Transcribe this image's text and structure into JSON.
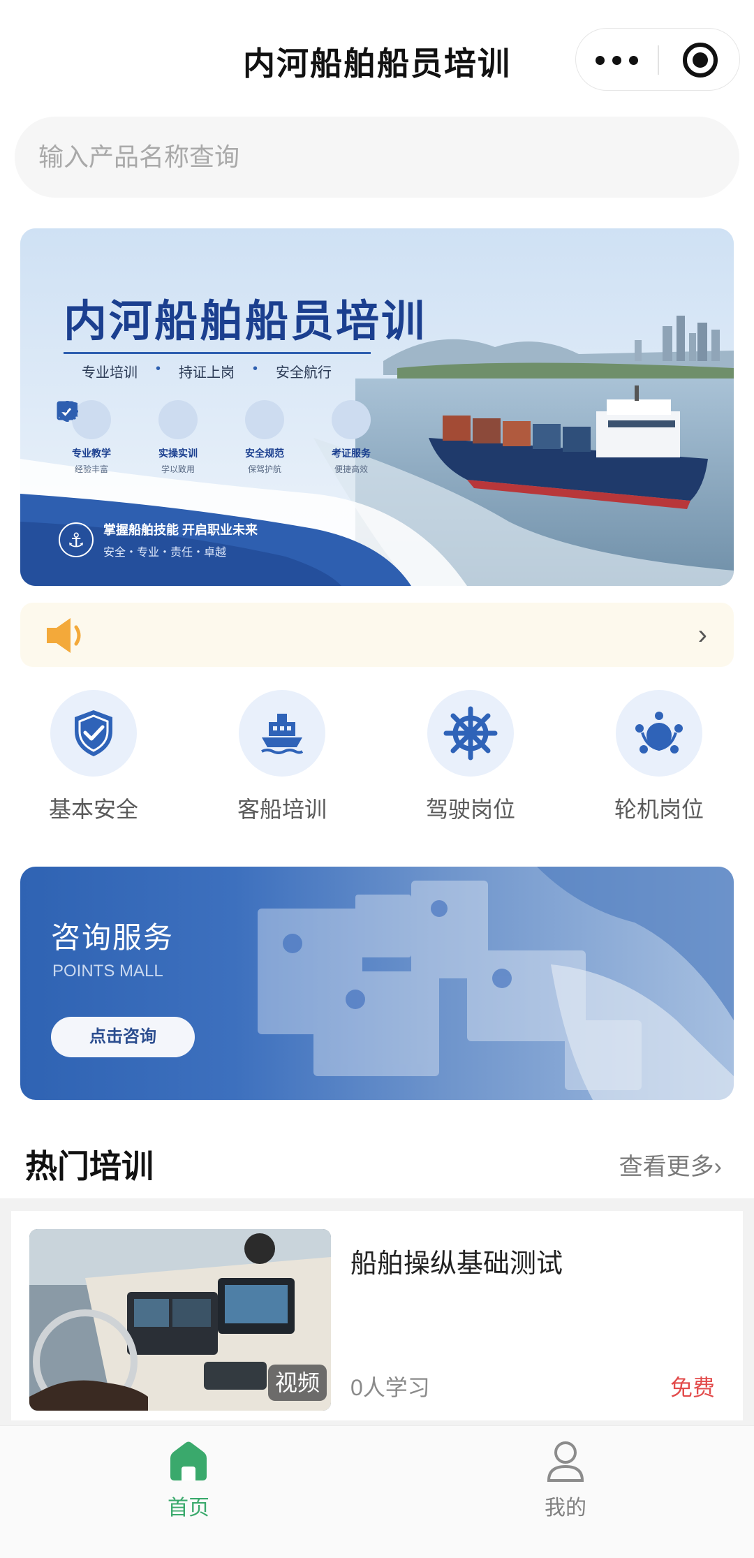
{
  "navbar": {
    "title": "内河船舶船员培训"
  },
  "search": {
    "placeholder": "输入产品名称查询"
  },
  "hero": {
    "title": "内河船舶船员培训",
    "tags": [
      "专业培训",
      "持证上岗",
      "安全航行"
    ],
    "features": [
      {
        "name": "专业教学",
        "sub": "经验丰富",
        "icon": "book-icon"
      },
      {
        "name": "实操实训",
        "sub": "学以致用",
        "icon": "ship-wheel-icon"
      },
      {
        "name": "安全规范",
        "sub": "保驾护航",
        "icon": "shield-check-icon"
      },
      {
        "name": "考证服务",
        "sub": "便捷高效",
        "icon": "certificate-icon"
      }
    ],
    "slogan_main": "掌握船舶技能  开启职业未来",
    "slogan_sub": "安全・专业・责任・卓越"
  },
  "notice": {
    "icon": "speaker-icon"
  },
  "categories": [
    {
      "label": "基本安全",
      "icon": "shield-check-icon"
    },
    {
      "label": "客船培训",
      "icon": "ship-icon"
    },
    {
      "label": "驾驶岗位",
      "icon": "ship-wheel-icon"
    },
    {
      "label": "轮机岗位",
      "icon": "engine-crew-icon"
    }
  ],
  "consult": {
    "title": "咨询服务",
    "subtitle": "POINTS MALL",
    "button": "点击咨询"
  },
  "section": {
    "title": "热门培训",
    "more": "查看更多"
  },
  "courses": [
    {
      "title": "船舶操纵基础测试",
      "badge": "视频",
      "learners": "0人学习",
      "price": "免费"
    }
  ],
  "tabbar": {
    "items": [
      {
        "label": "首页",
        "icon": "home-icon",
        "active": true
      },
      {
        "label": "我的",
        "icon": "person-icon",
        "active": false
      }
    ]
  },
  "colors": {
    "accent_green": "#3aa96c",
    "brand_blue": "#2e5fb0",
    "price_red": "#e24b4b",
    "notice_bg": "#fdf9ed"
  }
}
